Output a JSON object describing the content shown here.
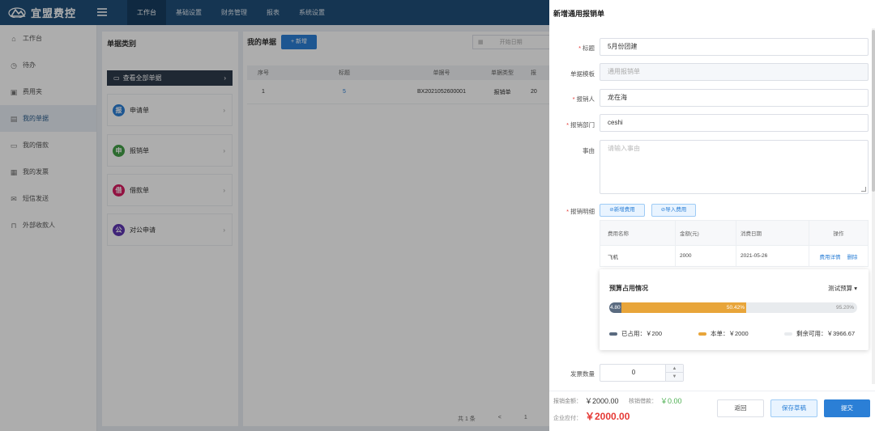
{
  "app": {
    "logo_text": "宜盟费控"
  },
  "nav": [
    "工作台",
    "基础设置",
    "财务管理",
    "报表",
    "系统设置"
  ],
  "sidebar": [
    {
      "label": "工作台",
      "icon": "home-icon"
    },
    {
      "label": "待办",
      "icon": "clock-icon"
    },
    {
      "label": "费用夹",
      "icon": "briefcase-icon"
    },
    {
      "label": "我的单据",
      "icon": "document-icon"
    },
    {
      "label": "我的借款",
      "icon": "folder-icon"
    },
    {
      "label": "我的发票",
      "icon": "invoice-icon"
    },
    {
      "label": "短信发送",
      "icon": "mail-icon"
    },
    {
      "label": "外部收款人",
      "icon": "bookmark-icon"
    }
  ],
  "categories": {
    "title": "单据类别",
    "view_all": "查看全部单据",
    "items": [
      {
        "badge": "报",
        "label": "申请单",
        "color": "#2b7fd6"
      },
      {
        "badge": "申",
        "label": "报销单",
        "color": "#43a047"
      },
      {
        "badge": "借",
        "label": "借款单",
        "color": "#d81b60"
      },
      {
        "badge": "公",
        "label": "对公申请",
        "color": "#5e35b1"
      }
    ]
  },
  "my_docs": {
    "title": "我的单据",
    "add_label": "+ 新增",
    "date_placeholder": "开始日期",
    "date_cut": "至",
    "columns": [
      "序号",
      "标题",
      "单据号",
      "单据类型",
      "报"
    ],
    "rows": [
      [
        "1",
        "5",
        "BX2021052600001",
        "报销单",
        "20"
      ]
    ],
    "pager_total": "共 1 条",
    "pager_prev": "<",
    "pager_page": "1"
  },
  "drawer": {
    "title": "新增通用报销单",
    "fields": {
      "title_label": "标题",
      "title_value": "5月份团建",
      "template_label": "单据模板",
      "template_value": "通用报销单",
      "person_label": "报销人",
      "person_value": "龙在海",
      "dept_label": "报销部门",
      "dept_value": "ceshi",
      "reason_label": "事由",
      "reason_placeholder": "请输入事由",
      "detail_label": "报销明细"
    },
    "buttons": {
      "add_expense": "新增费用",
      "import_expense": "导入费用"
    },
    "expense_table": {
      "columns": [
        "费用名称",
        "金额(元)",
        "消费日期",
        "操作"
      ],
      "rows": [
        {
          "name": "飞机",
          "amount": "2000",
          "date": "2021-05-26",
          "op_detail": "费用详情",
          "op_delete": "删除"
        }
      ]
    },
    "budget": {
      "title": "预算占用情况",
      "selector": "测试预算",
      "used_pct": 4.8,
      "this_pct": 50.42,
      "remain_pct": 95.2,
      "used_label": "4.80",
      "this_label": "50.42%",
      "remain_label": "95.20%",
      "legend_used": "已占用：￥200",
      "legend_this": "本单：￥2000",
      "legend_remain": "剩余可用：￥3966.67",
      "colors": {
        "used": "#5a6b80",
        "this": "#e8a53a",
        "remain": "#e8ebee"
      }
    },
    "invoice_count_label": "发票数量",
    "invoice_count": "0",
    "footer": {
      "total_label": "报销金额：",
      "total_value": "￥2000.00",
      "offset_label": "核销借款：",
      "offset_value": "￥0.00",
      "payable_label": "企业应付：",
      "payable_value": "￥2000.00",
      "return": "返回",
      "save_draft": "保存草稿",
      "submit": "提交"
    }
  }
}
